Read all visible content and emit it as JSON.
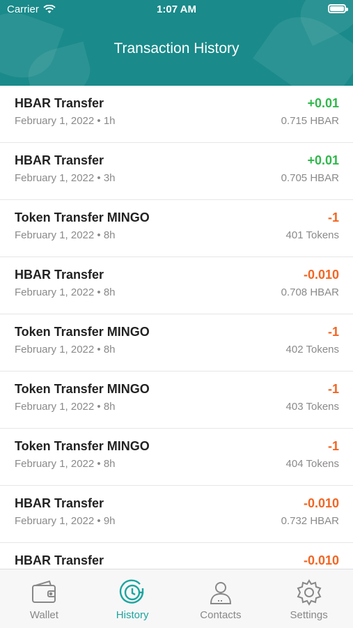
{
  "status": {
    "carrier": "Carrier",
    "time": "1:07 AM"
  },
  "header": {
    "title": "Transaction History"
  },
  "transactions": [
    {
      "title": "HBAR Transfer",
      "sub": "February 1, 2022 • 1h",
      "amount": "+0.01",
      "balance": "0.715 HBAR",
      "dir": "pos"
    },
    {
      "title": "HBAR Transfer",
      "sub": "February 1, 2022 • 3h",
      "amount": "+0.01",
      "balance": "0.705 HBAR",
      "dir": "pos"
    },
    {
      "title": "Token Transfer MINGO",
      "sub": "February 1, 2022 • 8h",
      "amount": "-1",
      "balance": "401 Tokens",
      "dir": "neg"
    },
    {
      "title": "HBAR Transfer",
      "sub": "February 1, 2022 • 8h",
      "amount": "-0.010",
      "balance": "0.708 HBAR",
      "dir": "neg"
    },
    {
      "title": "Token Transfer MINGO",
      "sub": "February 1, 2022 • 8h",
      "amount": "-1",
      "balance": "402 Tokens",
      "dir": "neg"
    },
    {
      "title": "Token Transfer MINGO",
      "sub": "February 1, 2022 • 8h",
      "amount": "-1",
      "balance": "403 Tokens",
      "dir": "neg"
    },
    {
      "title": "Token Transfer MINGO",
      "sub": "February 1, 2022 • 8h",
      "amount": "-1",
      "balance": "404 Tokens",
      "dir": "neg"
    },
    {
      "title": "HBAR Transfer",
      "sub": "February 1, 2022 • 9h",
      "amount": "-0.010",
      "balance": "0.732 HBAR",
      "dir": "neg"
    },
    {
      "title": "HBAR Transfer",
      "sub": "",
      "amount": "-0.010",
      "balance": "",
      "dir": "neg"
    }
  ],
  "tabs": [
    {
      "label": "Wallet",
      "icon": "wallet-icon",
      "active": false
    },
    {
      "label": "History",
      "icon": "history-icon",
      "active": true
    },
    {
      "label": "Contacts",
      "icon": "contacts-icon",
      "active": false
    },
    {
      "label": "Settings",
      "icon": "settings-icon",
      "active": false
    }
  ],
  "colors": {
    "header": "#1a8a8a",
    "positive": "#2fb84a",
    "negative": "#f26522",
    "tab_active": "#1ba5a0",
    "tab_inactive": "#888888"
  }
}
